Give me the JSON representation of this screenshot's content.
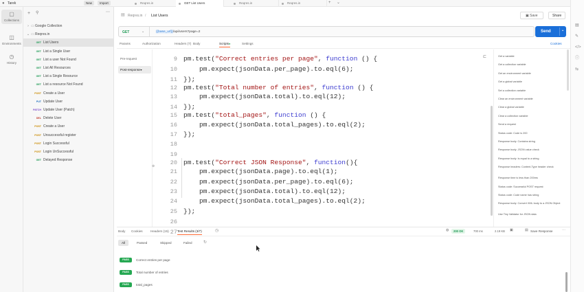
{
  "workspace": {
    "name": "Tarek",
    "new_label": "New",
    "import_label": "Import"
  },
  "rail": [
    {
      "label": "Collections",
      "icon": "collections-icon",
      "glyph": "▢",
      "active": true
    },
    {
      "label": "Environments",
      "icon": "environments-icon",
      "glyph": "◫",
      "active": false
    },
    {
      "label": "History",
      "icon": "history-icon",
      "glyph": "◷",
      "active": false
    }
  ],
  "collections": [
    {
      "name": "Google Collection",
      "method": "",
      "level": 0,
      "caret": "›"
    },
    {
      "name": "Reqres.in",
      "method": "",
      "level": 0,
      "caret": "⌄"
    },
    {
      "name": "List Users",
      "method": "GET",
      "level": 1,
      "selected": true
    },
    {
      "name": "List a Single User",
      "method": "GET",
      "level": 1
    },
    {
      "name": "List a user Not Found",
      "method": "GET",
      "level": 1
    },
    {
      "name": "List All Resources",
      "method": "GET",
      "level": 1
    },
    {
      "name": "List a Single Resource",
      "method": "GET",
      "level": 1
    },
    {
      "name": "List a resource Not Found",
      "method": "GET",
      "level": 1
    },
    {
      "name": "Create a User",
      "method": "POST",
      "level": 1
    },
    {
      "name": "Update User",
      "method": "PUT",
      "level": 1
    },
    {
      "name": "Update User (Patch)",
      "method": "PATCH",
      "level": 1
    },
    {
      "name": "Delete User",
      "method": "DEL",
      "level": 1
    },
    {
      "name": "Create a User",
      "method": "POST",
      "level": 1
    },
    {
      "name": "Unsuccessful register",
      "method": "POST",
      "level": 1
    },
    {
      "name": "Login Successful",
      "method": "POST",
      "level": 1
    },
    {
      "name": "Login UnSuccessful",
      "method": "POST",
      "level": 1
    },
    {
      "name": "Delayed Response",
      "method": "GET",
      "level": 1
    }
  ],
  "method_colors": {
    "GET": "#1f9a55",
    "POST": "#c98a00",
    "PUT": "#1f6fbf",
    "PATCH": "#7a49c9",
    "DEL": "#c0392b"
  },
  "tabs": [
    {
      "label": "Reqres.in",
      "active": false
    },
    {
      "label": "GET List Users",
      "active": true
    },
    {
      "label": "Reqres.in",
      "active": false
    },
    {
      "label": "Reqres.in",
      "active": false
    }
  ],
  "breadcrumb": {
    "parent": "Reqres.in",
    "current": "List Users"
  },
  "save_label": "Save",
  "share_label": "Share",
  "request": {
    "method": "GET",
    "url": "{{base_url}}/api/users?page=2"
  },
  "send_label": "Send",
  "request_tabs": [
    "Params",
    "Authorization",
    "Headers (7)",
    "Body",
    "Scripts",
    "Settings"
  ],
  "active_request_tab": "Scripts",
  "cookies_label": "Cookies",
  "script_tabs": [
    "Pre-request",
    "Post-response"
  ],
  "code_lines": [
    {
      "n": "9",
      "html": "pm.test(<s>\"Correct entries per page\"</s>, <k>function</k> () {"
    },
    {
      "n": "10",
      "html": "    pm.expect(jsonData.per_page).to.eql(6);"
    },
    {
      "n": "11",
      "html": "});"
    },
    {
      "n": "12",
      "html": "pm.test(<s>\"Total number of entries\"</s>, <k>function</k> () {"
    },
    {
      "n": "13",
      "html": "    pm.expect(jsonData.total).to.eql(12);"
    },
    {
      "n": "14",
      "html": "});"
    },
    {
      "n": "15",
      "html": "pm.test(<s>\"total_pages\"</s>, <k>function</k> () {"
    },
    {
      "n": "16",
      "html": "    pm.expect(jsonData.total_pages).to.eql(2);"
    },
    {
      "n": "17",
      "html": "});"
    },
    {
      "n": "18",
      "html": ""
    },
    {
      "n": "19",
      "html": ""
    },
    {
      "n": "20",
      "html": "pm.test(<s>\"Correct JSON Response\"</s>, <k>function</k>(){"
    },
    {
      "n": "21",
      "html": "    pm.expect(jsonData.page).to.eql(1);"
    },
    {
      "n": "22",
      "html": "    pm.expect(jsonData.per_page).to.eql(6);"
    },
    {
      "n": "23",
      "html": "    pm.expect(jsonData.total).to.eql(12);"
    },
    {
      "n": "24",
      "html": "    pm.expect(jsonData.total_pages).to.eql(2);"
    },
    {
      "n": "25",
      "html": "});"
    },
    {
      "n": "26",
      "html": ""
    },
    {
      "n": "27",
      "html": ""
    }
  ],
  "snippets": [
    "Get a variable",
    "Get a collection variable",
    "Get an environment variable",
    "Get a global variable",
    "Set a collection variable",
    "Clear an environment variable",
    "Clear a global variable",
    "Clear a collection variable",
    "Send a request",
    "Status code: Code is 200",
    "Response body: Contains string",
    "Response body: JSON value check",
    "Response body: Is equal to a string",
    "Response headers: Content-Type header check",
    "Response time is less than 200ms",
    "Status code: Successful POST request",
    "Status code: Code name has string",
    "Response body: Convert XML body to a JSON Object",
    "Use Tiny Validator for JSON data"
  ],
  "response_tabs": [
    "Body",
    "Cookies",
    "Headers (15)",
    "Test Results (3/7)"
  ],
  "active_response_tab": "Test Results (3/7)",
  "status": {
    "code": "200 OK",
    "time": "700 ms",
    "size": "2.19 KB"
  },
  "save_response_label": "Save Response",
  "filters": [
    "All",
    "Passed",
    "Skipped",
    "Failed"
  ],
  "active_filter": "All",
  "results": [
    {
      "status": "PASS",
      "name": "Correct entries per page"
    },
    {
      "status": "PASS",
      "name": "Total number of entries"
    },
    {
      "status": "PASS",
      "name": "total_pages"
    }
  ]
}
